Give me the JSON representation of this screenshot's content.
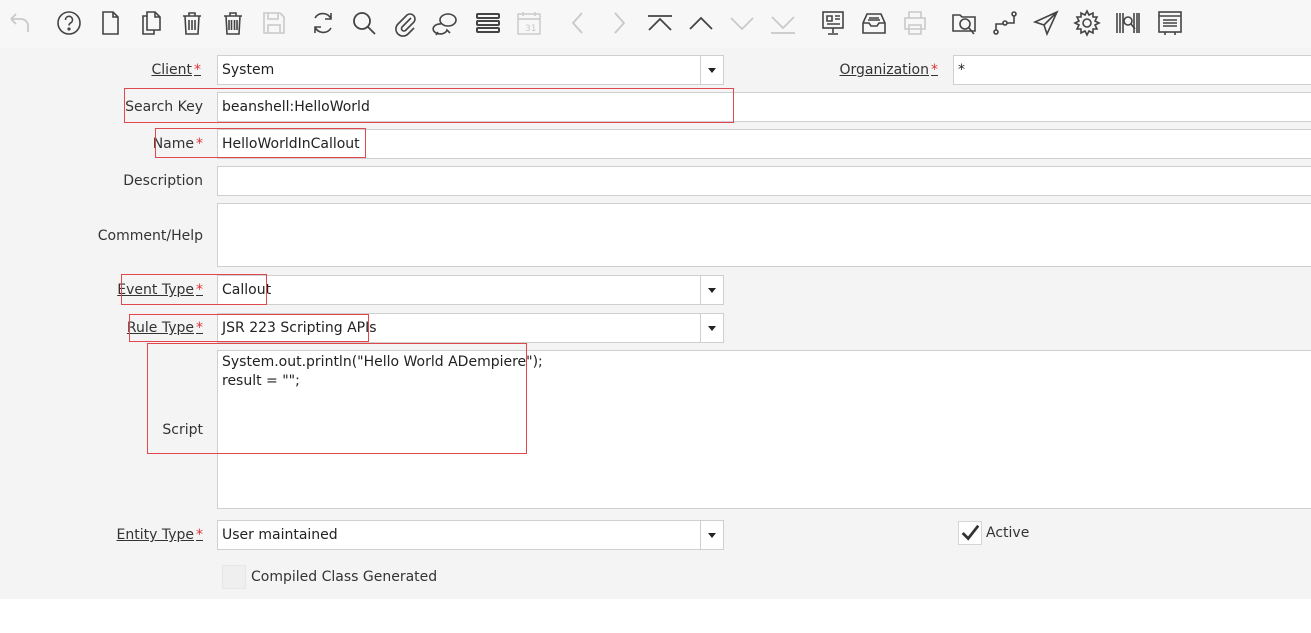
{
  "toolbar": {
    "icons": [
      "undo-icon",
      "help-icon",
      "new-record-icon",
      "copy-record-icon",
      "delete-icon",
      "delete-selected-icon",
      "save-icon",
      "refresh-icon",
      "find-icon",
      "attachment-icon",
      "chat-icon",
      "grid-toggle-icon",
      "calendar-icon",
      "previous-record-icon",
      "next-record-icon",
      "first-record-icon",
      "parent-record-icon",
      "detail-record-icon",
      "last-record-icon",
      "report-icon",
      "archive-icon",
      "print-icon",
      "zoom-across-icon",
      "workflow-icon",
      "request-icon",
      "settings-icon",
      "product-info-icon",
      "customize-icon"
    ]
  },
  "form": {
    "client": {
      "label": "Client",
      "value": "System"
    },
    "organization": {
      "label": "Organization",
      "value": "*"
    },
    "search_key": {
      "label": "Search Key",
      "value": "beanshell:HelloWorld"
    },
    "name": {
      "label": "Name",
      "value": "HelloWorldInCallout"
    },
    "description": {
      "label": "Description",
      "value": ""
    },
    "comment_help": {
      "label": "Comment/Help",
      "value": ""
    },
    "event_type": {
      "label": "Event Type",
      "value": "Callout"
    },
    "rule_type": {
      "label": "Rule Type",
      "value": "JSR 223 Scripting APIs"
    },
    "script": {
      "label": "Script",
      "value": "System.out.println(\"Hello World ADempiere\");\nresult = \"\";"
    },
    "entity_type": {
      "label": "Entity Type",
      "value": "User maintained"
    },
    "active": {
      "label": "Active",
      "checked": true
    },
    "compiled_class": {
      "label": "Compiled Class Generated",
      "checked": false
    },
    "required_mark": "*"
  }
}
